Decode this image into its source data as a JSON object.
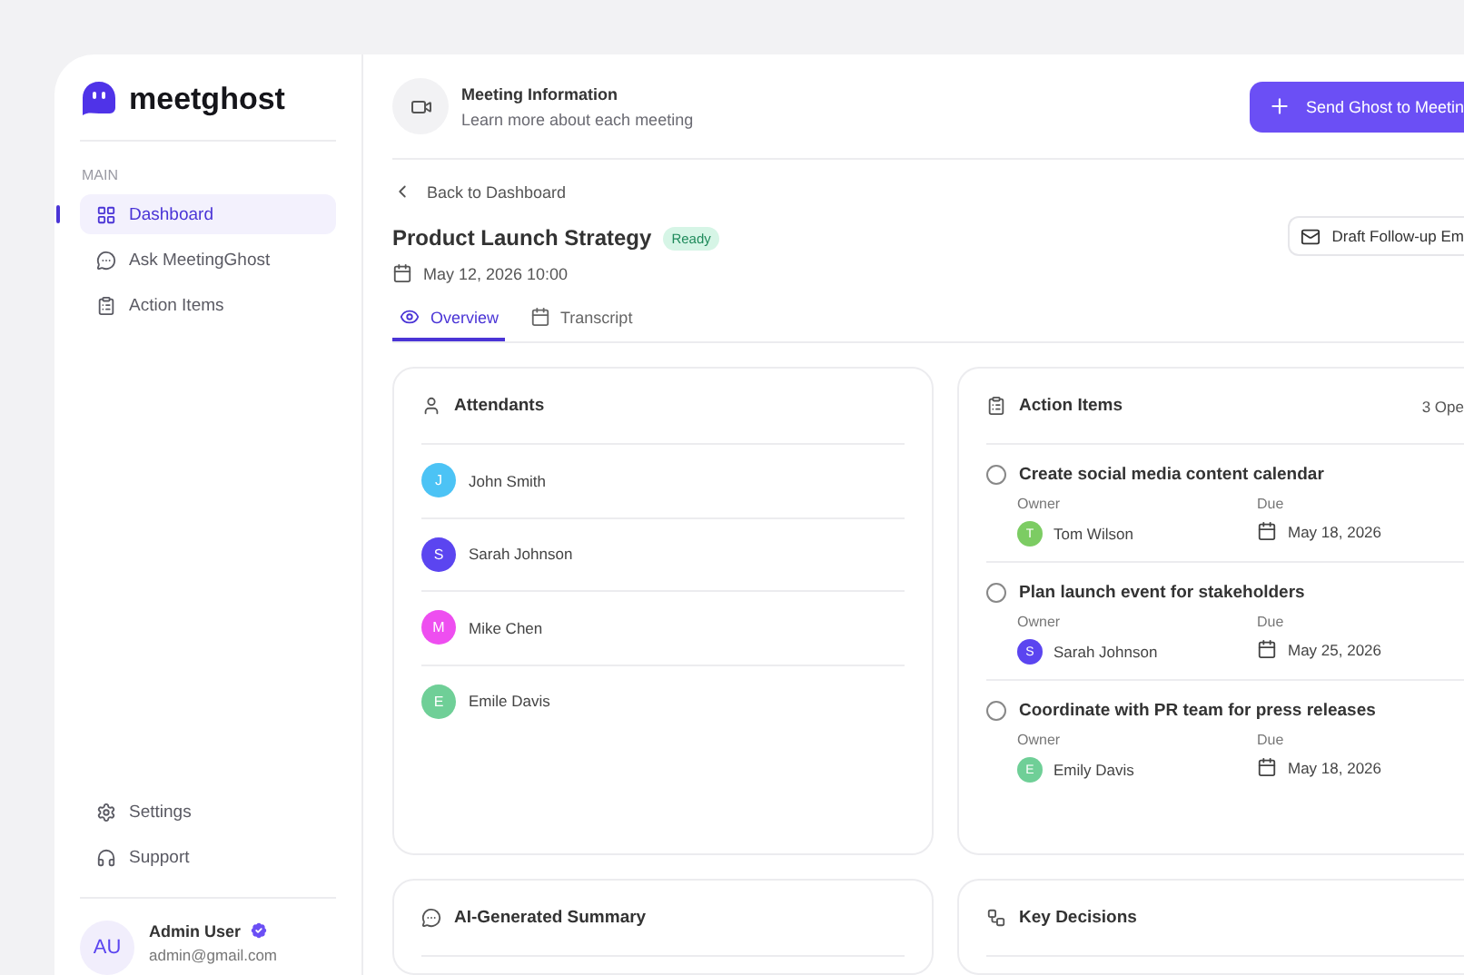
{
  "brand": {
    "name": "meetghost"
  },
  "sidebar": {
    "section": "MAIN",
    "items": [
      {
        "label": "Dashboard",
        "selected": true
      },
      {
        "label": "Ask MeetingGhost",
        "selected": false
      },
      {
        "label": "Action Items",
        "selected": false
      }
    ],
    "bottom_items": [
      {
        "label": "Settings"
      },
      {
        "label": "Support"
      }
    ],
    "user": {
      "initials": "AU",
      "name": "Admin User",
      "verified": true,
      "email": "admin@gmail.com"
    }
  },
  "header": {
    "title": "Meeting Information",
    "subtitle": "Learn more about each meeting",
    "button": "Send Ghost to Meetin"
  },
  "back_link": "Back to Dashboard",
  "meeting": {
    "title": "Product Launch Strategy",
    "status": "Ready",
    "date": "May 12, 2026 10:00",
    "email_button": "Draft Follow-up Em"
  },
  "tabs": [
    {
      "label": "Overview",
      "selected": true
    },
    {
      "label": "Transcript",
      "selected": false
    }
  ],
  "attendants": {
    "title": "Attendants",
    "people": [
      {
        "initial": "J",
        "name": "John Smith",
        "color": "#4cc3f5"
      },
      {
        "initial": "S",
        "name": "Sarah Johnson",
        "color": "#5b45f0"
      },
      {
        "initial": "M",
        "name": "Mike Chen",
        "color": "#ee4ef0"
      },
      {
        "initial": "E",
        "name": "Emile Davis",
        "color": "#6fcf97"
      }
    ]
  },
  "action_items": {
    "title": "Action Items",
    "count": "3 Ope",
    "items": [
      {
        "title": "Create social media content calendar",
        "checked": false,
        "owner_label": "Owner",
        "owner_initial": "T",
        "owner": "Tom Wilson",
        "color": "#7ccc63",
        "due_label": "Due",
        "due": "May 18, 2026"
      },
      {
        "title": "Plan launch event for stakeholders",
        "checked": false,
        "owner_label": "Owner",
        "owner_initial": "S",
        "owner": "Sarah Johnson",
        "color": "#5b45f0",
        "due_label": "Due",
        "due": "May 25, 2026"
      },
      {
        "title": "Coordinate with PR team for press releases",
        "checked": false,
        "owner_label": "Owner",
        "owner_initial": "E",
        "owner": "Emily Davis",
        "color": "#6fcf97",
        "due_label": "Due",
        "due": "May 18, 2026"
      }
    ]
  },
  "summary": {
    "title": "AI-Generated Summary"
  },
  "decisions": {
    "title": "Key Decisions"
  }
}
